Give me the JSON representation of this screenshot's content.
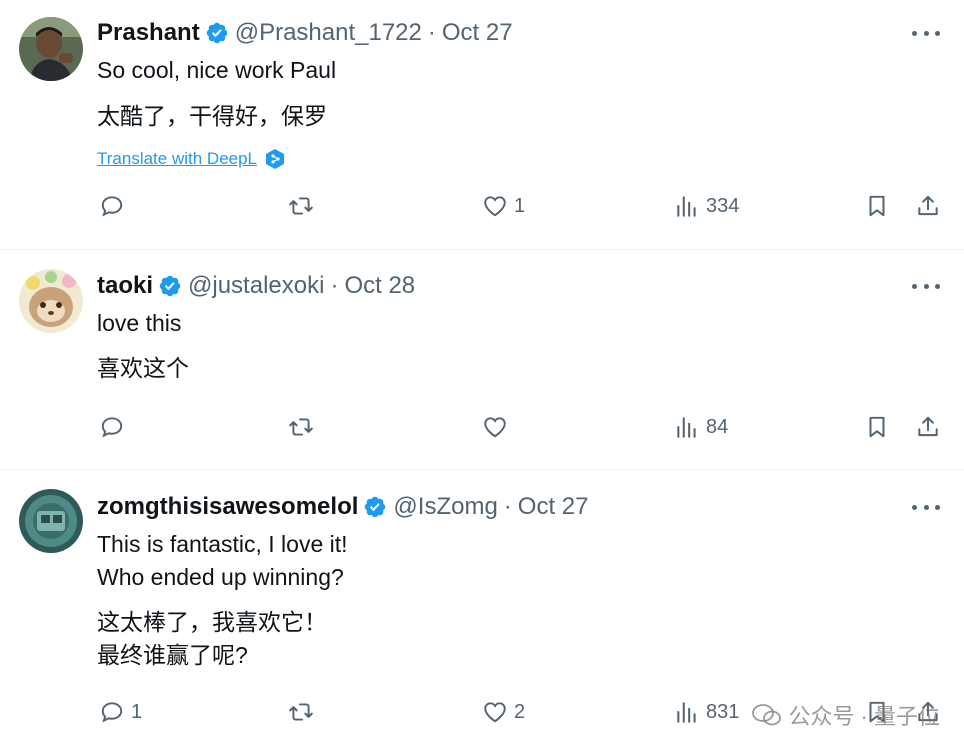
{
  "tweets": [
    {
      "name": "Prashant",
      "handle": "@Prashant_1722",
      "separator": "·",
      "date": "Oct 27",
      "lines_en": [
        "So cool, nice work Paul"
      ],
      "lines_zh": [
        "太酷了，干得好，保罗"
      ],
      "translate_label": "Translate with DeepL",
      "replies": "",
      "retweets": "",
      "likes": "1",
      "views": "334"
    },
    {
      "name": "taoki",
      "handle": "@justalexoki",
      "separator": "·",
      "date": "Oct 28",
      "lines_en": [
        "love this"
      ],
      "lines_zh": [
        "喜欢这个"
      ],
      "replies": "",
      "retweets": "",
      "likes": "",
      "views": "84"
    },
    {
      "name": "zomgthisisawesomelol",
      "handle": "@IsZomg",
      "separator": "·",
      "date": "Oct 27",
      "lines_en": [
        "This is fantastic, I love it!",
        "Who ended up winning?"
      ],
      "lines_zh": [
        "这太棒了，我喜欢它！",
        "最终谁赢了呢?"
      ],
      "replies": "1",
      "retweets": "",
      "likes": "2",
      "views": "831"
    }
  ],
  "watermark": "公众号 · 量子位",
  "icons": {
    "reply": "reply-icon",
    "retweet": "retweet-icon",
    "like": "heart-icon",
    "views": "views-icon",
    "bookmark": "bookmark-icon",
    "share": "share-icon",
    "more": "more-icon",
    "verified": "verified-badge-icon"
  },
  "colors": {
    "verified": "#1d9bf0",
    "link": "#1d9bf0",
    "secondary_text": "#536471"
  }
}
